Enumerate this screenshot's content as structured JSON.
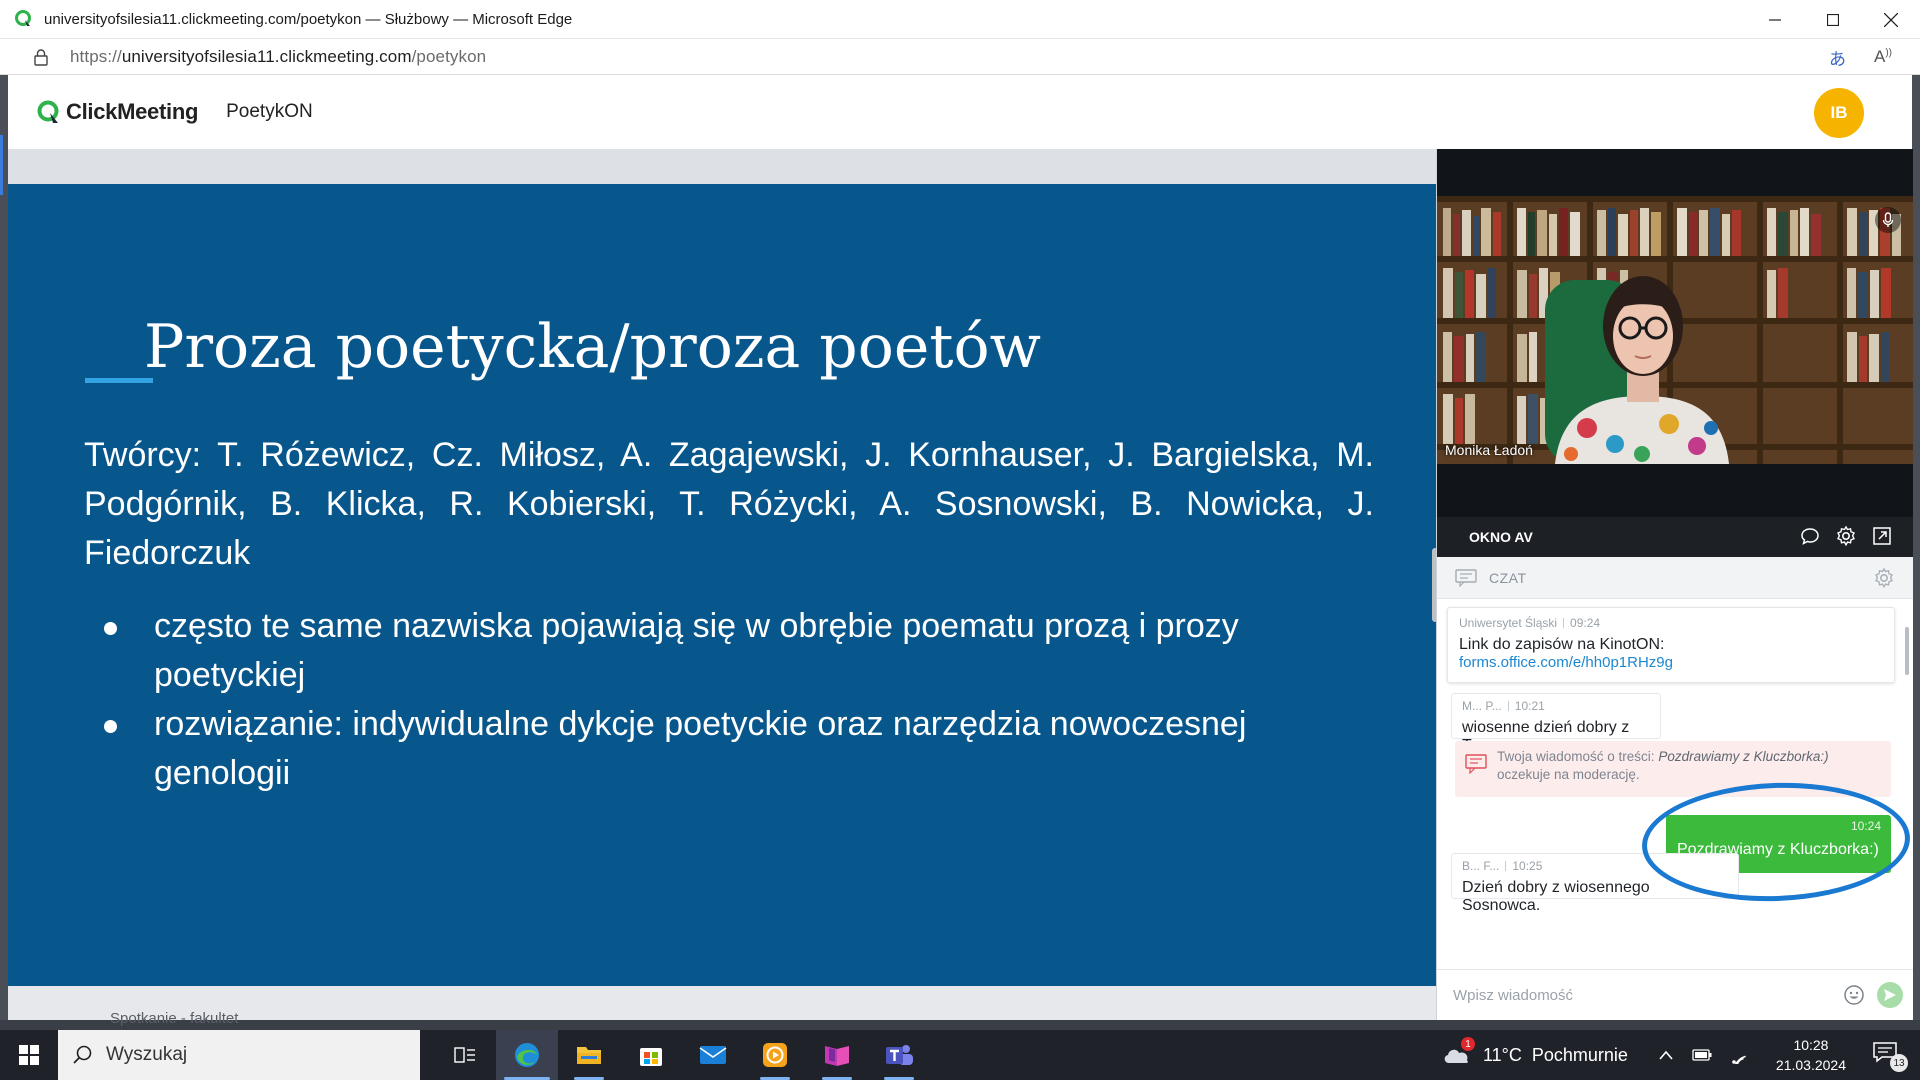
{
  "browser": {
    "window_title": "universityofsilesia11.clickmeeting.com/poetykon — Służbowy — Microsoft Edge",
    "url_scheme": "https://",
    "url_host": "universityofsilesia11.clickmeeting.com",
    "url_path": "/poetykon"
  },
  "header": {
    "logo_text": "ClickMeeting",
    "room_name": "PoetykON",
    "avatar_initials": "IB"
  },
  "slide": {
    "title": "Proza poetycka/proza poetów",
    "creators": "Twórcy: T. Różewicz, Cz. Miłosz, A. Zagajewski, J. Kornhauser, J. Bargielska, M. Podgórnik, B. Klicka, R. Kobierski, T. Różycki, A. Sosnowski, B. Nowicka, J. Fiedorczuk",
    "bullets": [
      "często te same nazwiska pojawiają się w obrębie poematu prozą i prozy poetyckiej",
      "rozwiązanie: indywidualne dykcje poetyckie oraz narzędzia nowoczesnej genologii"
    ]
  },
  "av": {
    "presenter_name": "Monika Ładoń",
    "panel_label": "OKNO AV"
  },
  "chat": {
    "header_label": "CZAT",
    "pinned": {
      "author": "Uniwersytet Śląski",
      "time": "09:24",
      "text": "Link do zapisów na KinotON:",
      "link": "forms.office.com/e/hh0p1RHz9g"
    },
    "messages": [
      {
        "author": "M... P...",
        "time": "10:21",
        "text": "wiosenne dzień dobry z Tarnowa"
      },
      {
        "author": "B... F...",
        "time": "10:25",
        "text": "Dzień dobry z wiosennego Sosnowca."
      }
    ],
    "moderation": {
      "prefix": "Twoja wiadomość o treści: ",
      "quoted": "Pozdrawiamy z Kluczborka:)",
      "suffix": "oczekuje na moderację."
    },
    "own_message": {
      "time": "10:24",
      "text": "Pozdrawiamy z Kluczborka:)"
    },
    "input_placeholder": "Wpisz wiadomość"
  },
  "behind_window": {
    "partial_text": "Spotkanie - fakultet"
  },
  "taskbar": {
    "search_placeholder": "Wyszukaj",
    "weather": "11°C  Pochmurnie",
    "weather_alert": "1",
    "time": "10:28",
    "date": "21.03.2024",
    "notifications": "13"
  },
  "colors": {
    "slide_background": "#07568c",
    "accent_green": "#3bba3b",
    "avatar_yellow": "#f6b400",
    "highlight_circle": "#1a79d1"
  }
}
